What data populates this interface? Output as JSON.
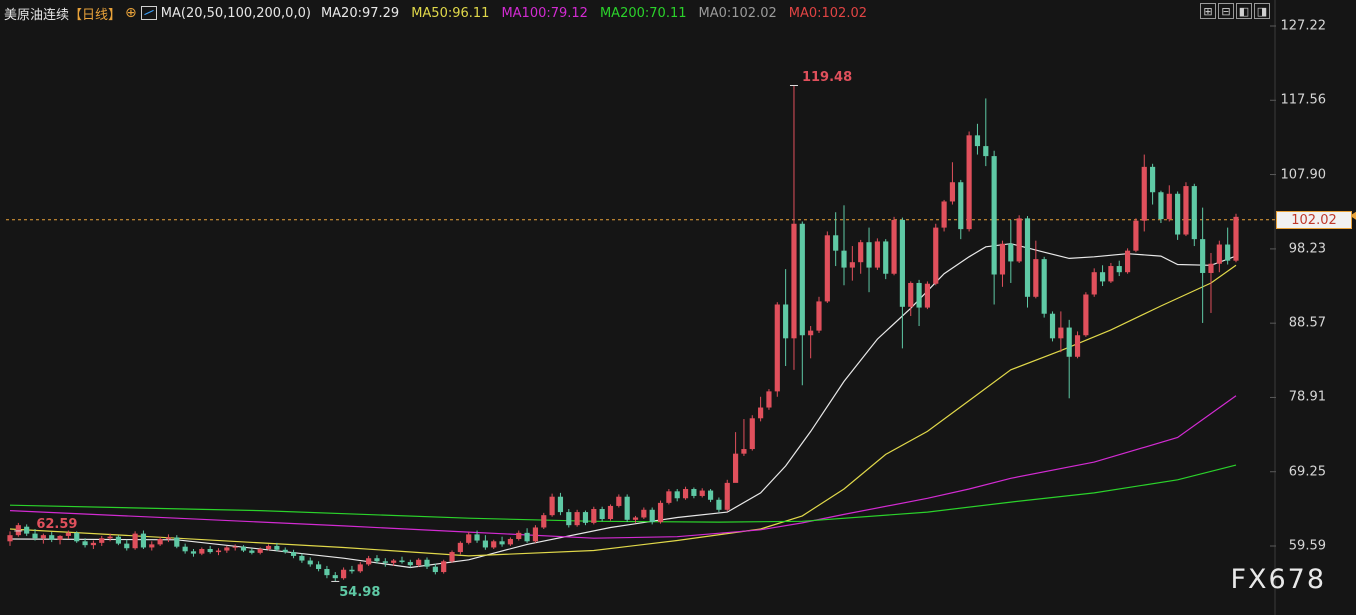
{
  "header": {
    "title": "美原油连续",
    "period_tag": "【日线】",
    "plus_glyph": "⊕",
    "ma_label": "MA(20,50,100,200,0,0)",
    "ma_values": [
      {
        "text": "MA20:97.29",
        "color": "#e8e8e8"
      },
      {
        "text": "MA50:96.11",
        "color": "#e0d84a"
      },
      {
        "text": "MA100:79.12",
        "color": "#d22bd2"
      },
      {
        "text": "MA200:70.11",
        "color": "#2bd22b"
      },
      {
        "text": "MA0:102.02",
        "color": "#9a9a9a"
      },
      {
        "text": "MA0:102.02",
        "color": "#e04444"
      }
    ]
  },
  "toolbar": [
    "⊞",
    "⊟",
    "◧",
    "◨"
  ],
  "watermark": "FX678",
  "colors": {
    "background": "#151515",
    "up": "#e0505c",
    "down": "#5fc9a5",
    "grid": "#2a2a2a",
    "current_price_line": "#e8a23a"
  },
  "chart_data": {
    "type": "candlestick",
    "title": "美原油连续【日线】",
    "ylim": [
      52,
      127.22
    ],
    "y_ticks": [
      "127.22",
      "117.56",
      "107.90",
      "98.23",
      "88.57",
      "78.91",
      "69.25",
      "59.59"
    ],
    "current_price": 102.02,
    "current_price_label": "102.02",
    "annotations": {
      "high": {
        "label": "119.48",
        "value": 119.48,
        "color": "#e0505c"
      },
      "start": {
        "label": "62.59",
        "value": 62.59,
        "color": "#e0505c"
      },
      "low": {
        "label": "54.98",
        "value": 54.98,
        "color": "#5fc9a5"
      }
    },
    "ohlc": [
      [
        60.2,
        61.5,
        59.6,
        61.0
      ],
      [
        61.0,
        62.59,
        60.8,
        62.3
      ],
      [
        62.1,
        62.4,
        60.9,
        61.2
      ],
      [
        61.2,
        61.8,
        60.3,
        60.6
      ],
      [
        60.6,
        61.2,
        59.9,
        61.0
      ],
      [
        61.0,
        61.4,
        60.1,
        60.4
      ],
      [
        60.4,
        61.0,
        59.8,
        60.9
      ],
      [
        60.9,
        61.6,
        60.5,
        61.3
      ],
      [
        61.3,
        61.5,
        60.0,
        60.2
      ],
      [
        60.2,
        60.6,
        59.4,
        59.7
      ],
      [
        59.7,
        60.3,
        59.2,
        60.0
      ],
      [
        60.0,
        60.9,
        59.6,
        60.6
      ],
      [
        60.6,
        61.2,
        60.2,
        60.8
      ],
      [
        60.8,
        61.0,
        59.7,
        59.9
      ],
      [
        59.9,
        60.4,
        59.0,
        59.3
      ],
      [
        59.3,
        61.5,
        59.1,
        61.2
      ],
      [
        61.2,
        61.6,
        59.2,
        59.4
      ],
      [
        59.4,
        60.2,
        59.0,
        59.8
      ],
      [
        59.8,
        60.8,
        59.6,
        60.5
      ],
      [
        60.5,
        61.1,
        60.1,
        60.7
      ],
      [
        60.7,
        61.0,
        59.3,
        59.5
      ],
      [
        59.5,
        59.9,
        58.6,
        58.9
      ],
      [
        58.9,
        59.2,
        58.2,
        58.6
      ],
      [
        58.6,
        59.4,
        58.4,
        59.2
      ],
      [
        59.2,
        59.6,
        58.6,
        58.8
      ],
      [
        58.8,
        59.3,
        58.4,
        59.0
      ],
      [
        59.0,
        59.6,
        58.7,
        59.4
      ],
      [
        59.4,
        59.8,
        59.0,
        59.5
      ],
      [
        59.5,
        59.7,
        58.8,
        59.0
      ],
      [
        59.0,
        59.3,
        58.5,
        58.7
      ],
      [
        58.7,
        59.4,
        58.5,
        59.2
      ],
      [
        59.2,
        59.8,
        59.0,
        59.6
      ],
      [
        59.6,
        60.0,
        58.9,
        59.1
      ],
      [
        59.1,
        59.4,
        58.6,
        58.8
      ],
      [
        58.8,
        59.1,
        58.0,
        58.3
      ],
      [
        58.3,
        58.6,
        57.4,
        57.7
      ],
      [
        57.7,
        58.1,
        56.9,
        57.2
      ],
      [
        57.2,
        57.6,
        56.3,
        56.6
      ],
      [
        56.6,
        57.0,
        55.4,
        55.8
      ],
      [
        55.8,
        56.2,
        54.98,
        55.4
      ],
      [
        55.4,
        56.8,
        55.2,
        56.5
      ],
      [
        56.5,
        57.0,
        56.0,
        56.3
      ],
      [
        56.3,
        57.5,
        56.1,
        57.2
      ],
      [
        57.2,
        58.3,
        57.0,
        58.0
      ],
      [
        58.0,
        58.4,
        57.3,
        57.6
      ],
      [
        57.6,
        58.0,
        56.9,
        57.4
      ],
      [
        57.4,
        57.9,
        57.0,
        57.7
      ],
      [
        57.7,
        58.2,
        57.3,
        57.5
      ],
      [
        57.5,
        57.8,
        56.8,
        57.1
      ],
      [
        57.1,
        58.0,
        56.9,
        57.8
      ],
      [
        57.8,
        58.1,
        56.6,
        56.9
      ],
      [
        56.9,
        57.3,
        55.9,
        56.2
      ],
      [
        56.2,
        57.8,
        56.0,
        57.6
      ],
      [
        57.6,
        59.0,
        57.4,
        58.8
      ],
      [
        58.8,
        60.2,
        58.5,
        60.0
      ],
      [
        60.0,
        61.4,
        59.8,
        61.1
      ],
      [
        61.1,
        61.6,
        60.0,
        60.3
      ],
      [
        60.3,
        61.0,
        59.1,
        59.4
      ],
      [
        59.4,
        60.4,
        59.2,
        60.2
      ],
      [
        60.2,
        60.8,
        59.5,
        59.8
      ],
      [
        59.8,
        60.7,
        59.6,
        60.5
      ],
      [
        60.5,
        61.6,
        60.3,
        61.3
      ],
      [
        61.3,
        61.9,
        60.0,
        60.2
      ],
      [
        60.2,
        62.3,
        60.0,
        62.0
      ],
      [
        62.0,
        63.9,
        61.8,
        63.6
      ],
      [
        63.6,
        66.4,
        63.4,
        66.0
      ],
      [
        66.0,
        66.5,
        63.6,
        64.0
      ],
      [
        64.0,
        64.4,
        62.0,
        62.3
      ],
      [
        62.3,
        64.3,
        62.1,
        64.0
      ],
      [
        64.0,
        64.2,
        62.3,
        62.6
      ],
      [
        62.6,
        64.7,
        62.4,
        64.4
      ],
      [
        64.4,
        64.7,
        62.8,
        63.1
      ],
      [
        63.1,
        65.0,
        62.9,
        64.8
      ],
      [
        64.8,
        66.3,
        64.6,
        66.0
      ],
      [
        66.0,
        66.3,
        62.7,
        63.0
      ],
      [
        63.0,
        63.5,
        62.6,
        63.3
      ],
      [
        63.3,
        64.6,
        63.1,
        64.3
      ],
      [
        64.3,
        64.6,
        62.4,
        62.7
      ],
      [
        62.7,
        65.5,
        62.5,
        65.2
      ],
      [
        65.2,
        67.0,
        65.0,
        66.7
      ],
      [
        66.7,
        67.0,
        65.4,
        65.8
      ],
      [
        65.8,
        67.3,
        65.6,
        67.0
      ],
      [
        67.0,
        67.2,
        65.8,
        66.1
      ],
      [
        66.1,
        67.1,
        65.9,
        66.8
      ],
      [
        66.8,
        67.0,
        65.3,
        65.6
      ],
      [
        65.6,
        65.9,
        64.0,
        64.3
      ],
      [
        64.3,
        68.2,
        64.1,
        67.8
      ],
      [
        67.8,
        74.4,
        69.4,
        71.6
      ],
      [
        71.6,
        76.1,
        71.3,
        72.2
      ],
      [
        72.2,
        76.6,
        72.0,
        76.2
      ],
      [
        76.2,
        79.0,
        75.8,
        77.6
      ],
      [
        77.6,
        80.0,
        77.3,
        79.7
      ],
      [
        79.7,
        91.3,
        79.0,
        91.0
      ],
      [
        91.0,
        95.6,
        83.0,
        86.6
      ],
      [
        86.6,
        119.48,
        82.5,
        101.5
      ],
      [
        101.5,
        101.8,
        80.5,
        87.0
      ],
      [
        87.0,
        88.2,
        84.0,
        87.6
      ],
      [
        87.6,
        92.0,
        87.3,
        91.4
      ],
      [
        91.4,
        100.5,
        91.2,
        100.0
      ],
      [
        100.0,
        103.0,
        96.0,
        98.0
      ],
      [
        98.0,
        103.9,
        93.5,
        95.8
      ],
      [
        95.8,
        98.6,
        94.1,
        96.5
      ],
      [
        96.5,
        99.4,
        95.0,
        99.1
      ],
      [
        99.1,
        101.0,
        92.6,
        95.8
      ],
      [
        95.8,
        99.6,
        95.5,
        99.2
      ],
      [
        99.2,
        99.5,
        94.3,
        95.0
      ],
      [
        95.0,
        102.4,
        94.8,
        102.0
      ],
      [
        102.0,
        102.3,
        85.3,
        90.7
      ],
      [
        90.7,
        94.0,
        89.5,
        93.8
      ],
      [
        93.8,
        94.2,
        88.2,
        90.6
      ],
      [
        90.6,
        94.0,
        90.4,
        93.7
      ],
      [
        93.7,
        101.5,
        93.5,
        101.0
      ],
      [
        101.0,
        104.6,
        100.5,
        104.4
      ],
      [
        104.4,
        109.5,
        104.0,
        106.9
      ],
      [
        106.9,
        107.2,
        99.5,
        100.8
      ],
      [
        100.8,
        113.5,
        100.5,
        113.0
      ],
      [
        113.0,
        114.5,
        110.5,
        111.6
      ],
      [
        111.6,
        117.8,
        109.0,
        110.3
      ],
      [
        110.3,
        111.0,
        91.0,
        94.9
      ],
      [
        94.9,
        99.3,
        93.3,
        98.9
      ],
      [
        98.9,
        102.0,
        93.8,
        96.6
      ],
      [
        96.6,
        102.6,
        96.4,
        102.2
      ],
      [
        102.2,
        102.5,
        90.6,
        92.0
      ],
      [
        92.0,
        99.3,
        91.8,
        96.9
      ],
      [
        96.9,
        97.2,
        89.3,
        89.8
      ],
      [
        89.8,
        90.1,
        86.2,
        86.6
      ],
      [
        86.6,
        90.1,
        84.8,
        88.0
      ],
      [
        88.0,
        89.0,
        78.8,
        84.2
      ],
      [
        84.2,
        87.5,
        84.0,
        87.0
      ],
      [
        87.0,
        92.6,
        86.8,
        92.3
      ],
      [
        92.3,
        95.7,
        92.0,
        95.2
      ],
      [
        95.2,
        96.1,
        93.4,
        94.0
      ],
      [
        94.0,
        96.4,
        93.8,
        96.0
      ],
      [
        96.0,
        96.7,
        94.7,
        95.2
      ],
      [
        95.2,
        98.3,
        95.0,
        98.0
      ],
      [
        98.0,
        102.2,
        97.8,
        101.9
      ],
      [
        101.9,
        110.5,
        100.5,
        108.9
      ],
      [
        108.9,
        109.3,
        104.0,
        105.6
      ],
      [
        105.6,
        105.8,
        101.6,
        102.1
      ],
      [
        102.1,
        106.5,
        101.8,
        105.4
      ],
      [
        105.4,
        105.7,
        99.4,
        100.1
      ],
      [
        100.1,
        106.9,
        99.9,
        106.4
      ],
      [
        106.4,
        106.7,
        98.6,
        99.5
      ],
      [
        99.5,
        103.6,
        88.6,
        95.1
      ],
      [
        95.1,
        97.7,
        89.9,
        96.3
      ],
      [
        96.3,
        99.3,
        95.2,
        98.8
      ],
      [
        98.8,
        101.0,
        96.2,
        96.7
      ],
      [
        96.7,
        102.8,
        96.5,
        102.4
      ]
    ],
    "ma_series": [
      {
        "name": "MA20",
        "color": "#e8e8e8",
        "values": [
          [
            0,
            60.5
          ],
          [
            20,
            60.4
          ],
          [
            40,
            58.0
          ],
          [
            48,
            56.8
          ],
          [
            55,
            57.8
          ],
          [
            62,
            59.8
          ],
          [
            72,
            62.0
          ],
          [
            80,
            63.3
          ],
          [
            86,
            64.0
          ],
          [
            90,
            66.5
          ],
          [
            93,
            70.0
          ],
          [
            96,
            74.5
          ],
          [
            100,
            81.0
          ],
          [
            104,
            86.5
          ],
          [
            108,
            90.5
          ],
          [
            112,
            95.0
          ],
          [
            115,
            97.2
          ],
          [
            117,
            98.5
          ],
          [
            120,
            98.9
          ],
          [
            124,
            97.8
          ],
          [
            127,
            97.0
          ],
          [
            130,
            97.2
          ],
          [
            134,
            97.6
          ],
          [
            138,
            97.3
          ],
          [
            140,
            96.2
          ],
          [
            144,
            96.1
          ],
          [
            147,
            97.29
          ]
        ]
      },
      {
        "name": "MA50",
        "color": "#e0d84a",
        "values": [
          [
            0,
            61.8
          ],
          [
            20,
            60.6
          ],
          [
            40,
            59.4
          ],
          [
            55,
            58.3
          ],
          [
            70,
            59.0
          ],
          [
            80,
            60.3
          ],
          [
            90,
            61.8
          ],
          [
            95,
            63.5
          ],
          [
            100,
            67.0
          ],
          [
            105,
            71.5
          ],
          [
            110,
            74.5
          ],
          [
            115,
            78.5
          ],
          [
            120,
            82.5
          ],
          [
            126,
            85.0
          ],
          [
            132,
            87.7
          ],
          [
            138,
            90.8
          ],
          [
            144,
            93.8
          ],
          [
            147,
            96.11
          ]
        ]
      },
      {
        "name": "MA100",
        "color": "#d22bd2",
        "values": [
          [
            0,
            64.2
          ],
          [
            20,
            63.2
          ],
          [
            40,
            62.2
          ],
          [
            55,
            61.4
          ],
          [
            70,
            60.6
          ],
          [
            80,
            60.8
          ],
          [
            90,
            61.7
          ],
          [
            95,
            62.6
          ],
          [
            100,
            63.7
          ],
          [
            110,
            65.8
          ],
          [
            115,
            67.0
          ],
          [
            120,
            68.4
          ],
          [
            130,
            70.5
          ],
          [
            140,
            73.7
          ],
          [
            147,
            79.12
          ]
        ]
      },
      {
        "name": "MA200",
        "color": "#2bd22b",
        "values": [
          [
            0,
            64.9
          ],
          [
            30,
            64.2
          ],
          [
            55,
            63.2
          ],
          [
            70,
            62.8
          ],
          [
            85,
            62.7
          ],
          [
            95,
            62.8
          ],
          [
            110,
            64.0
          ],
          [
            120,
            65.3
          ],
          [
            130,
            66.5
          ],
          [
            140,
            68.2
          ],
          [
            147,
            70.11
          ]
        ]
      }
    ]
  }
}
